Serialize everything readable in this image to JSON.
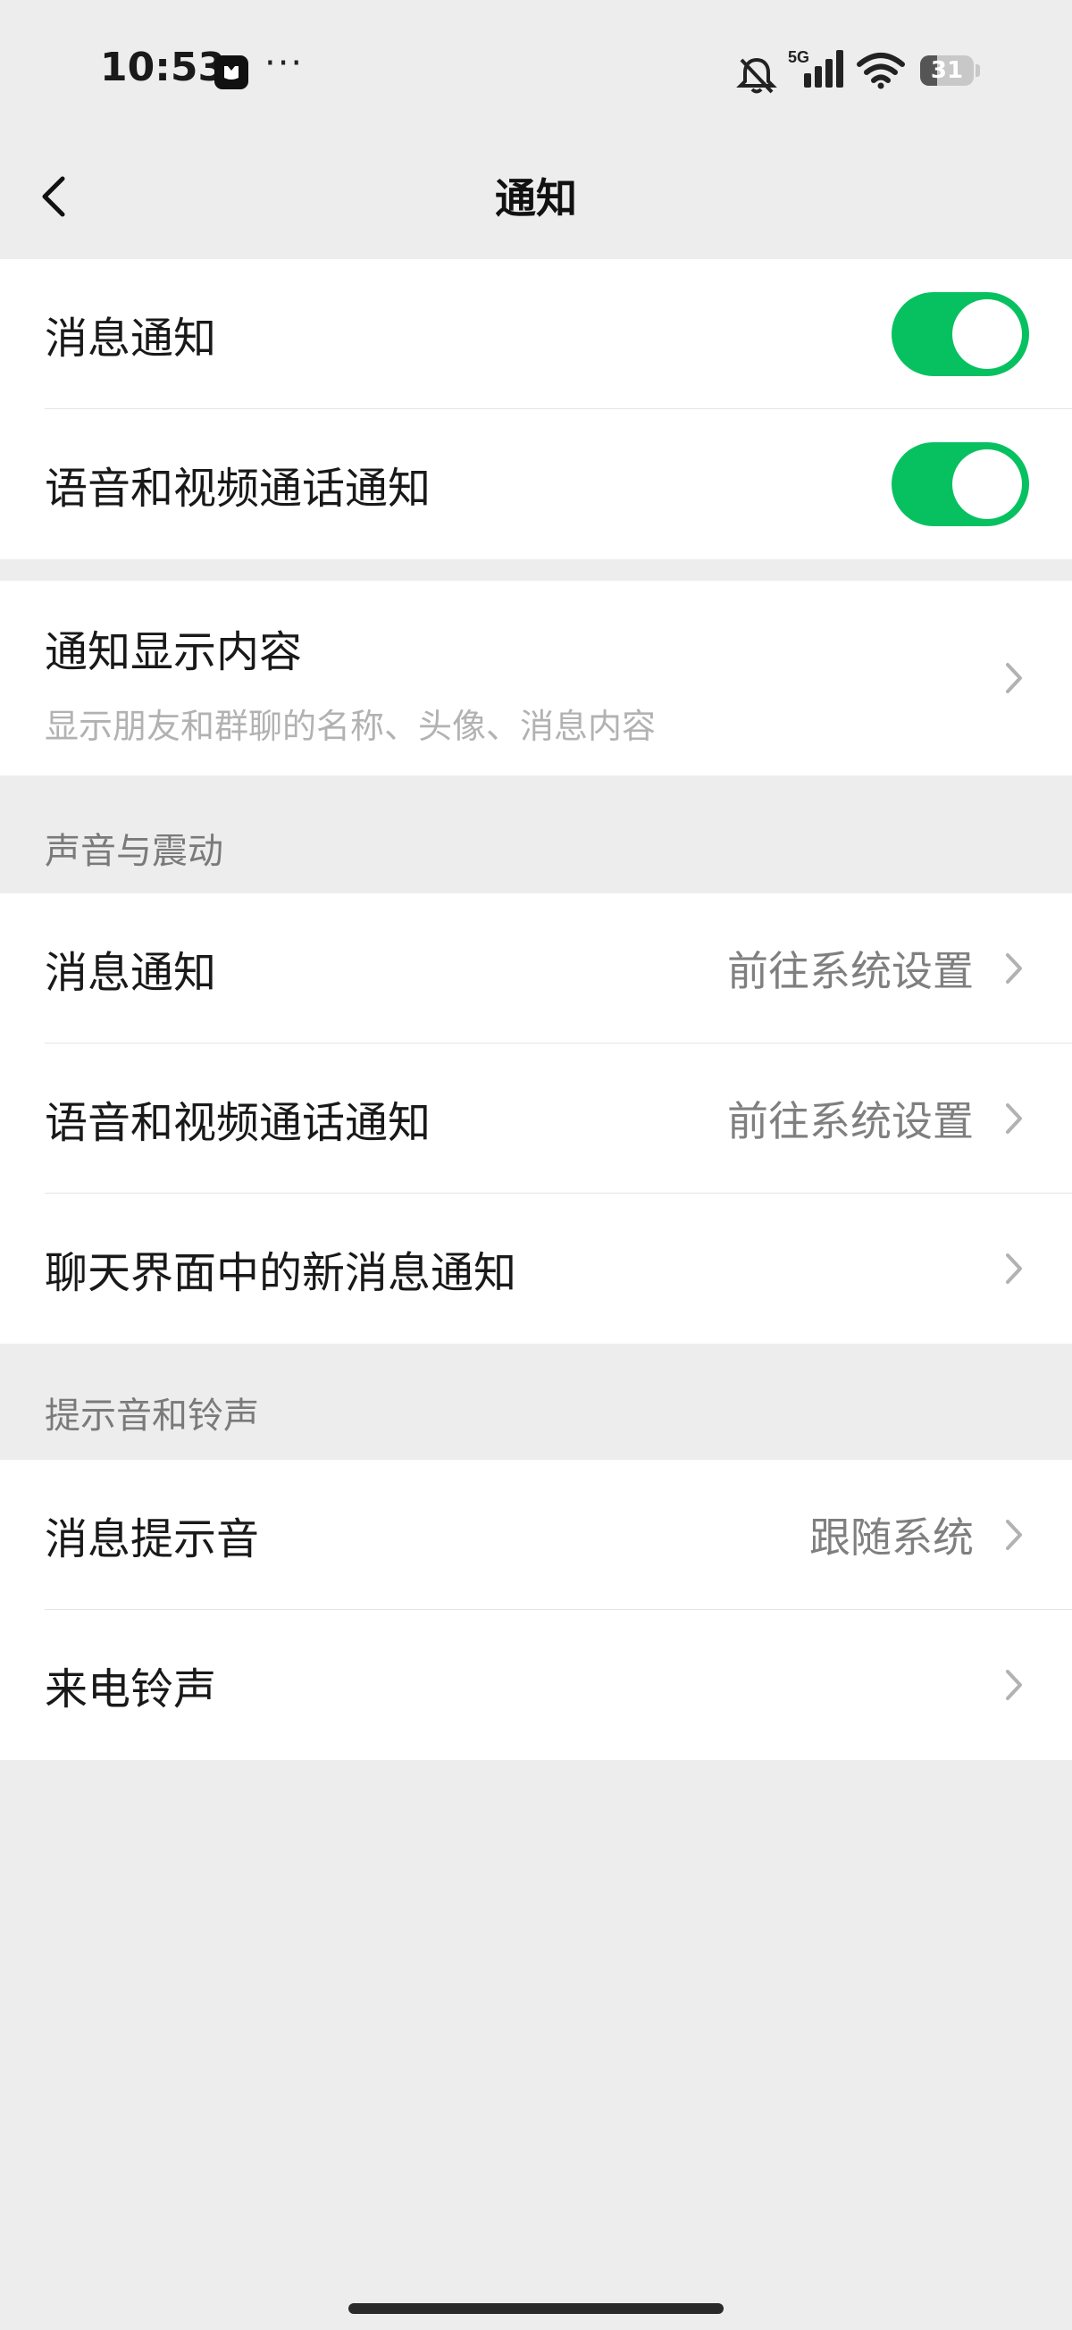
{
  "status_bar": {
    "time": "10:53",
    "dots": "···",
    "network": "5G",
    "battery": "31",
    "battery_level": 0.31
  },
  "nav": {
    "title": "通知",
    "back_icon": "chevron-left-icon"
  },
  "group1": {
    "items": [
      {
        "label": "消息通知",
        "toggle_on": true
      },
      {
        "label": "语音和视频通话通知",
        "toggle_on": true
      }
    ]
  },
  "group2": {
    "title": "通知显示内容",
    "subtitle": "显示朋友和群聊的名称、头像、消息内容"
  },
  "section_sound": {
    "header": "声音与震动",
    "items": [
      {
        "label": "消息通知",
        "value": "前往系统设置"
      },
      {
        "label": "语音和视频通话通知",
        "value": "前往系统设置"
      },
      {
        "label": "聊天界面中的新消息通知",
        "value": ""
      }
    ]
  },
  "section_ringtone": {
    "header": "提示音和铃声",
    "items": [
      {
        "label": "消息提示音",
        "value": "跟随系统"
      },
      {
        "label": "来电铃声",
        "value": ""
      }
    ]
  },
  "colors": {
    "accent": "#07c160",
    "background": "#ededed"
  }
}
